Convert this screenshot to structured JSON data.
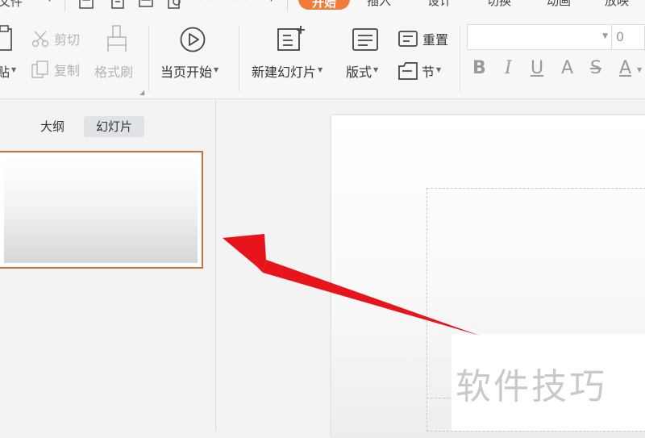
{
  "menubar": {
    "file_label": "文件",
    "tabs": [
      {
        "label": "开始",
        "active": true
      },
      {
        "label": "插入"
      },
      {
        "label": "设计"
      },
      {
        "label": "切换"
      },
      {
        "label": "动画"
      },
      {
        "label": "放映"
      }
    ]
  },
  "ribbon": {
    "paste_label": "贴",
    "cut_label": "剪切",
    "copy_label": "复制",
    "format_painter_label": "格式刷",
    "start_from_current_label": "当页开始",
    "new_slide_label": "新建幻灯片",
    "layout_label": "版式",
    "reset_label": "重置",
    "section_label": "节",
    "font_name_value": "",
    "font_size_value": "0",
    "format_buttons": [
      "B",
      "I",
      "U",
      "A",
      "S",
      "A"
    ]
  },
  "left_panel": {
    "tabs": [
      {
        "label": "大纲",
        "active": false
      },
      {
        "label": "幻灯片",
        "active": true
      }
    ]
  },
  "watermark": "软件技巧",
  "colors": {
    "accent": "#f27b3a",
    "thumb_border": "#c7713c",
    "arrow": "#e8141b"
  }
}
